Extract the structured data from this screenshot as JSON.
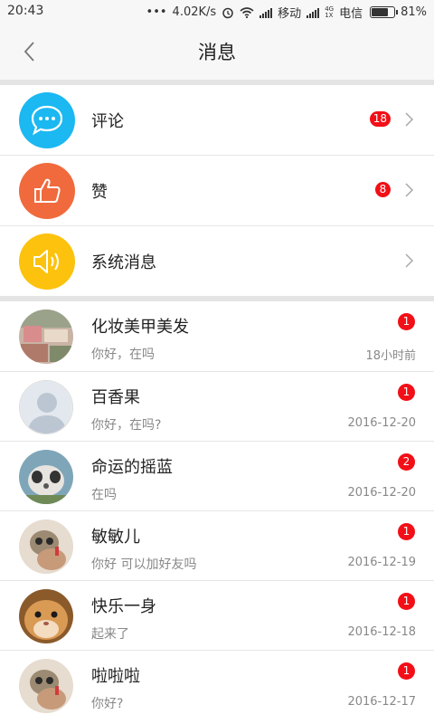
{
  "status_bar": {
    "time": "20:43",
    "dots": "•••",
    "speed": "4.02K/s",
    "carrier1": "移动",
    "net_4g": "4G",
    "net_1x": "1X",
    "carrier2": "电信",
    "battery": "81%"
  },
  "header": {
    "title": "消息",
    "back_icon": "chevron-left-icon"
  },
  "categories": [
    {
      "label": "评论",
      "badge": "18",
      "icon": "chat-bubble-icon",
      "color": "#1bb8f2"
    },
    {
      "label": "赞",
      "badge": "8",
      "icon": "thumbs-up-icon",
      "color": "#f06a3d"
    },
    {
      "label": "系统消息",
      "badge": "",
      "icon": "speaker-icon",
      "color": "#fcc20d"
    }
  ],
  "conversations": [
    {
      "name": "化妆美甲美发",
      "preview": "你好，在吗",
      "time": "18小时前",
      "badge": "1",
      "avatar": "shop-photo-avatar"
    },
    {
      "name": "百香果",
      "preview": "你好，在吗?",
      "time": "2016-12-20",
      "badge": "1",
      "avatar": "default-user-avatar"
    },
    {
      "name": "命运的摇蓝",
      "preview": "在吗",
      "time": "2016-12-20",
      "badge": "2",
      "avatar": "animal-photo-avatar"
    },
    {
      "name": "敏敏儿",
      "preview": "你好 可以加好友吗",
      "time": "2016-12-19",
      "badge": "1",
      "avatar": "lemur-photo-avatar"
    },
    {
      "name": "快乐一身",
      "preview": "起来了",
      "time": "2016-12-18",
      "badge": "1",
      "avatar": "hamster-photo-avatar"
    },
    {
      "name": "啦啦啦",
      "preview": "你好?",
      "time": "2016-12-17",
      "badge": "1",
      "avatar": "lemur-photo-avatar"
    }
  ]
}
